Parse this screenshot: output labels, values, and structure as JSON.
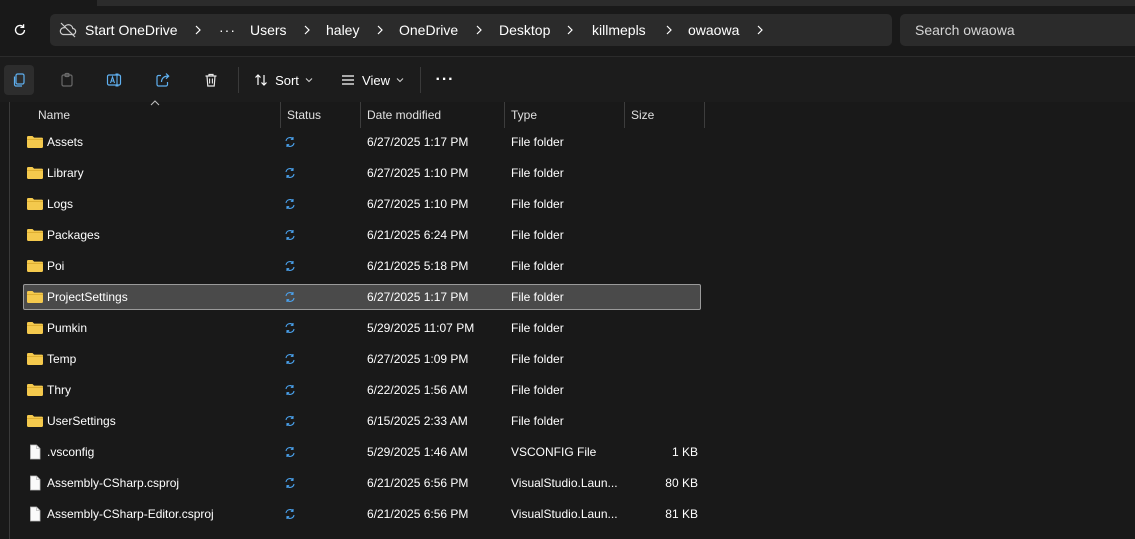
{
  "address_bar": {
    "onedrive_label": "Start OneDrive",
    "overflow": "···",
    "crumbs": [
      "Users",
      "haley",
      "OneDrive",
      "Desktop",
      "killmepls",
      "owaowa"
    ]
  },
  "search": {
    "placeholder": "Search owaowa"
  },
  "toolbar": {
    "sort_label": "Sort",
    "view_label": "View",
    "more_label": "···"
  },
  "columns": {
    "name": "Name",
    "status": "Status",
    "date": "Date modified",
    "type": "Type",
    "size": "Size"
  },
  "files": [
    {
      "name": "Assets",
      "date": "6/27/2025 1:17 PM",
      "type": "File folder",
      "size": "",
      "kind": "folder"
    },
    {
      "name": "Library",
      "date": "6/27/2025 1:10 PM",
      "type": "File folder",
      "size": "",
      "kind": "folder"
    },
    {
      "name": "Logs",
      "date": "6/27/2025 1:10 PM",
      "type": "File folder",
      "size": "",
      "kind": "folder"
    },
    {
      "name": "Packages",
      "date": "6/21/2025 6:24 PM",
      "type": "File folder",
      "size": "",
      "kind": "folder"
    },
    {
      "name": "Poi",
      "date": "6/21/2025 5:18 PM",
      "type": "File folder",
      "size": "",
      "kind": "folder"
    },
    {
      "name": "ProjectSettings",
      "date": "6/27/2025 1:17 PM",
      "type": "File folder",
      "size": "",
      "kind": "folder",
      "selected": true
    },
    {
      "name": "Pumkin",
      "date": "5/29/2025 11:07 PM",
      "type": "File folder",
      "size": "",
      "kind": "folder"
    },
    {
      "name": "Temp",
      "date": "6/27/2025 1:09 PM",
      "type": "File folder",
      "size": "",
      "kind": "folder"
    },
    {
      "name": "Thry",
      "date": "6/22/2025 1:56 AM",
      "type": "File folder",
      "size": "",
      "kind": "folder"
    },
    {
      "name": "UserSettings",
      "date": "6/15/2025 2:33 AM",
      "type": "File folder",
      "size": "",
      "kind": "folder"
    },
    {
      "name": ".vsconfig",
      "date": "5/29/2025 1:46 AM",
      "type": "VSCONFIG File",
      "size": "1 KB",
      "kind": "file"
    },
    {
      "name": "Assembly-CSharp.csproj",
      "date": "6/21/2025 6:56 PM",
      "type": "VisualStudio.Laun...",
      "size": "80 KB",
      "kind": "file"
    },
    {
      "name": "Assembly-CSharp-Editor.csproj",
      "date": "6/21/2025 6:56 PM",
      "type": "VisualStudio.Laun...",
      "size": "81 KB",
      "kind": "file"
    }
  ],
  "colors": {
    "folder": "#f4c94d",
    "sync": "#4aa3f0",
    "background": "#191919"
  },
  "icons": {
    "toolbar": [
      "copy-icon",
      "paste-icon",
      "rename-icon",
      "share-icon",
      "delete-icon",
      "sort-icon",
      "view-icon",
      "more-icon"
    ],
    "status": "sync-pending-icon"
  }
}
